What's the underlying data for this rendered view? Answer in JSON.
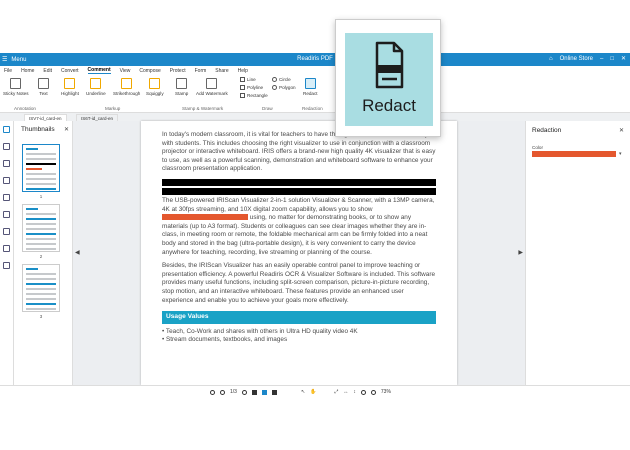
{
  "titlebar": {
    "menu_label": "Menu",
    "title": "Readiris PDF",
    "online_store": "Online Store"
  },
  "menubar": [
    "File",
    "Home",
    "Edit",
    "Convert",
    "Comment",
    "View",
    "Compose",
    "Protect",
    "Form",
    "Share",
    "Help"
  ],
  "ribbon": {
    "tools": [
      "Sticky Notes",
      "Text",
      "Highlight",
      "Underline",
      "Strikethrough",
      "Squiggly",
      "Stamp",
      "Add Watermark",
      "Redact"
    ],
    "draw": [
      "Line",
      "Polyline",
      "Rectangle",
      "Circle",
      "Polygon"
    ],
    "groups": [
      "Annotation",
      "Markup",
      "Stamp & Watermark",
      "Draw",
      "Redaction"
    ]
  },
  "tabs": [
    "ISV7-id_card-en",
    "IS6T-id_card-en"
  ],
  "thumbnails": {
    "title": "Thumbnails",
    "page_numbers": [
      "1",
      "2",
      "3"
    ]
  },
  "document": {
    "p1": "In today's modern classroom, it is vital for teachers to have the right tools to interact effectively with students. This includes choosing the right visualizer to use in conjunction with a classroom projector or interactive whiteboard. IRIS offers a brand-new high quality 4K visualizer that is easy to use, as well as a powerful scanning, demonstration and whiteboard software to enhance your classroom presentation application.",
    "p2a": "The USB-powered IRIScan Visualizer 2-in-1 solution Visualizer & Scanner, with a 13MP camera, 4K at 30fps streaming, and 10X digital zoom capability, allows you to show",
    "p2b": "using, no matter for demonstrating books, or to show any materials (up to A3 format). Students or colleagues can see clear images whether they are in-class, in meeting room or remote, the foldable mechanical arm can be firmly folded into a neat body and stored in the bag (ultra-portable design), it is very convenient to carry the device anywhere for teaching, recording, live streaming or planning of the course.",
    "p3": "Besides, the IRIScan Visualizer has an easily operable control panel to improve teaching or presentation efficiency. A powerful Readiris OCR & Visualizer Software is included. This software provides many useful functions, including split-screen comparison, picture-in-picture recording, stop motion, and an interactive whiteboard. These features provide an enhanced user experience and enable you to achieve your goals more effectively.",
    "section_title": "Usage Values",
    "bullets": [
      "Teach, Co-Work and shares with others in Ultra HD quality video 4K",
      "Stream documents, textbooks, and images"
    ]
  },
  "redaction_panel": {
    "title": "Redaction",
    "color_label": "Color",
    "color": "#e4572e"
  },
  "statusbar": {
    "page": "1/3",
    "zoom": "73%"
  },
  "popup": {
    "label": "Redact"
  }
}
